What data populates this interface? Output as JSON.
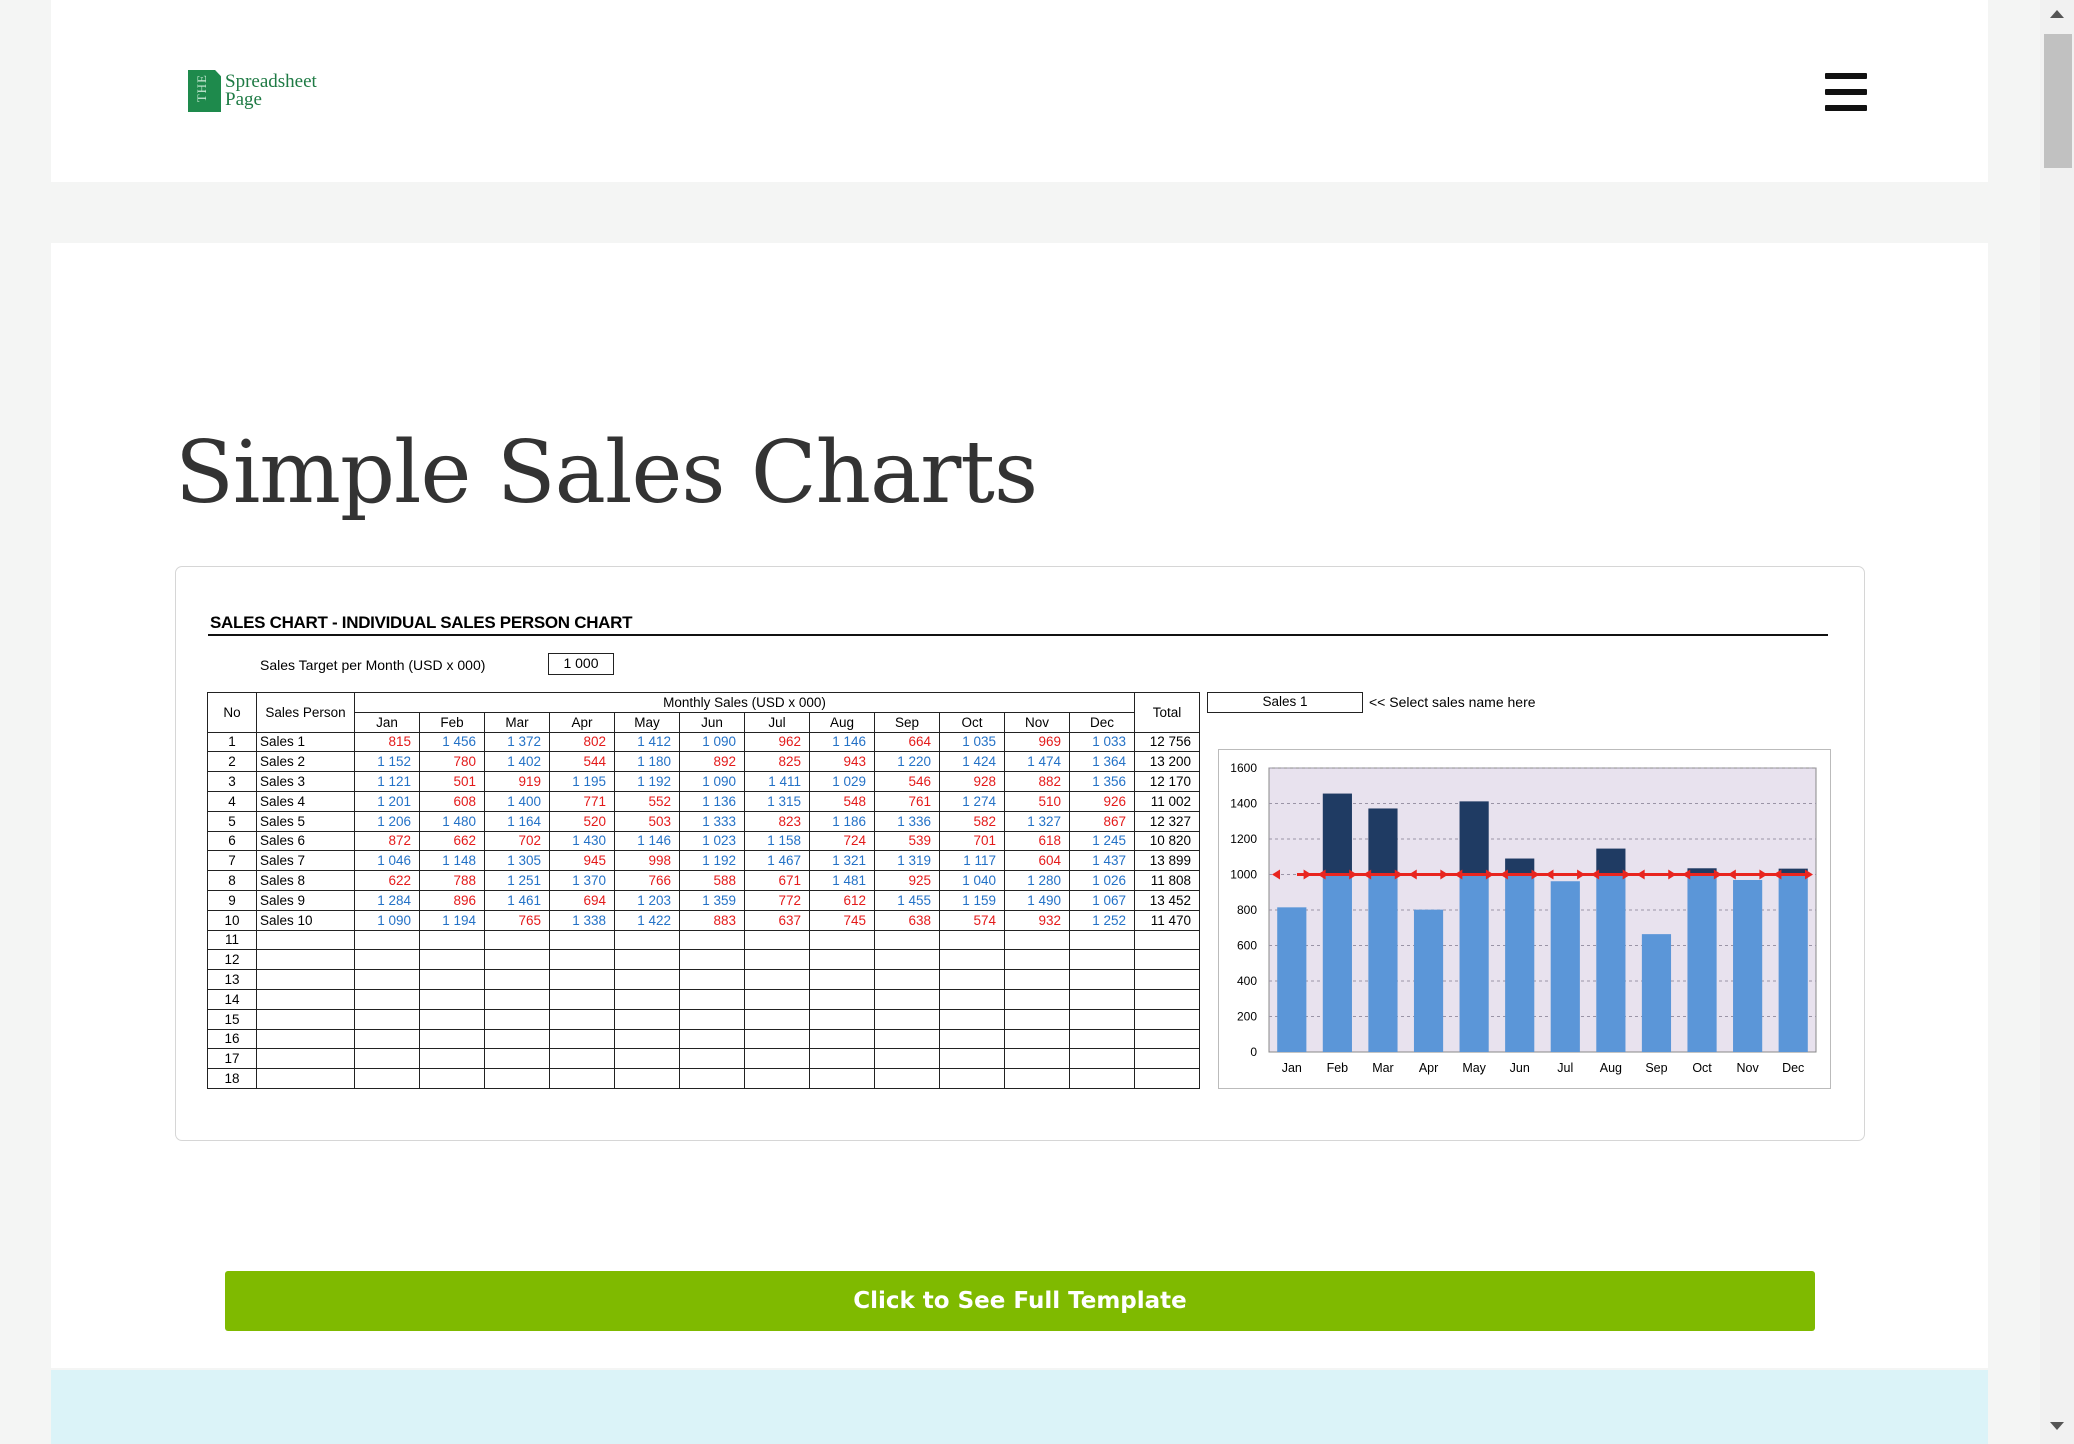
{
  "header": {
    "logo_mark": "THE",
    "logo_line1": "Spreadsheet",
    "logo_line2": "Page"
  },
  "page": {
    "title": "Simple Sales Charts",
    "cta_label": "Click to See Full Template"
  },
  "sheet": {
    "title": "SALES CHART - INDIVIDUAL SALES PERSON CHART",
    "target_label": "Sales Target per Month (USD x 000)",
    "target_value": "1 000",
    "columns": {
      "no": "No",
      "person": "Sales Person",
      "monthly": "Monthly Sales (USD x 000)",
      "total": "Total",
      "months": [
        "Jan",
        "Feb",
        "Mar",
        "Apr",
        "May",
        "Jun",
        "Jul",
        "Aug",
        "Sep",
        "Oct",
        "Nov",
        "Dec"
      ]
    },
    "rows": [
      {
        "no": "1",
        "name": "Sales 1",
        "values": [
          "815",
          "1 456",
          "1 372",
          "802",
          "1 412",
          "1 090",
          "962",
          "1 146",
          "664",
          "1 035",
          "969",
          "1 033"
        ],
        "total": "12 756"
      },
      {
        "no": "2",
        "name": "Sales 2",
        "values": [
          "1 152",
          "780",
          "1 402",
          "544",
          "1 180",
          "892",
          "825",
          "943",
          "1 220",
          "1 424",
          "1 474",
          "1 364"
        ],
        "total": "13 200"
      },
      {
        "no": "3",
        "name": "Sales 3",
        "values": [
          "1 121",
          "501",
          "919",
          "1 195",
          "1 192",
          "1 090",
          "1 411",
          "1 029",
          "546",
          "928",
          "882",
          "1 356"
        ],
        "total": "12 170"
      },
      {
        "no": "4",
        "name": "Sales 4",
        "values": [
          "1 201",
          "608",
          "1 400",
          "771",
          "552",
          "1 136",
          "1 315",
          "548",
          "761",
          "1 274",
          "510",
          "926"
        ],
        "total": "11 002"
      },
      {
        "no": "5",
        "name": "Sales 5",
        "values": [
          "1 206",
          "1 480",
          "1 164",
          "520",
          "503",
          "1 333",
          "823",
          "1 186",
          "1 336",
          "582",
          "1 327",
          "867"
        ],
        "total": "12 327"
      },
      {
        "no": "6",
        "name": "Sales 6",
        "values": [
          "872",
          "662",
          "702",
          "1 430",
          "1 146",
          "1 023",
          "1 158",
          "724",
          "539",
          "701",
          "618",
          "1 245"
        ],
        "total": "10 820"
      },
      {
        "no": "7",
        "name": "Sales 7",
        "values": [
          "1 046",
          "1 148",
          "1 305",
          "945",
          "998",
          "1 192",
          "1 467",
          "1 321",
          "1 319",
          "1 117",
          "604",
          "1 437"
        ],
        "total": "13 899"
      },
      {
        "no": "8",
        "name": "Sales 8",
        "values": [
          "622",
          "788",
          "1 251",
          "1 370",
          "766",
          "588",
          "671",
          "1 481",
          "925",
          "1 040",
          "1 280",
          "1 026"
        ],
        "total": "11 808"
      },
      {
        "no": "9",
        "name": "Sales 9",
        "values": [
          "1 284",
          "896",
          "1 461",
          "694",
          "1 203",
          "1 359",
          "772",
          "612",
          "1 455",
          "1 159",
          "1 490",
          "1 067"
        ],
        "total": "13 452"
      },
      {
        "no": "10",
        "name": "Sales 10",
        "values": [
          "1 090",
          "1 194",
          "765",
          "1 338",
          "1 422",
          "883",
          "637",
          "745",
          "638",
          "574",
          "932",
          "1 252"
        ],
        "total": "11 470"
      }
    ],
    "empty_rows": [
      "11",
      "12",
      "13",
      "14",
      "15",
      "16",
      "17",
      "18"
    ],
    "selected_name": "Sales 1",
    "select_hint": "<< Select sales name here",
    "colors": {
      "above_target": "#2371c6",
      "below_target": "#e31a1a"
    }
  },
  "chart_data": {
    "type": "bar",
    "categories": [
      "Jan",
      "Feb",
      "Mar",
      "Apr",
      "May",
      "Jun",
      "Jul",
      "Aug",
      "Sep",
      "Oct",
      "Nov",
      "Dec"
    ],
    "values": [
      815,
      1456,
      1372,
      802,
      1412,
      1090,
      962,
      1146,
      664,
      1035,
      969,
      1033
    ],
    "target": 1000,
    "ylim": [
      0,
      1600
    ],
    "yticks": [
      0,
      200,
      400,
      600,
      800,
      1000,
      1200,
      1400,
      1600
    ],
    "title": "",
    "xlabel": "",
    "ylabel": "",
    "grid": true,
    "colors": {
      "base": "#5b96d8",
      "excess": "#1f3b63",
      "target_line": "#e8251f",
      "plot_bg": "#e8e2ee"
    }
  }
}
